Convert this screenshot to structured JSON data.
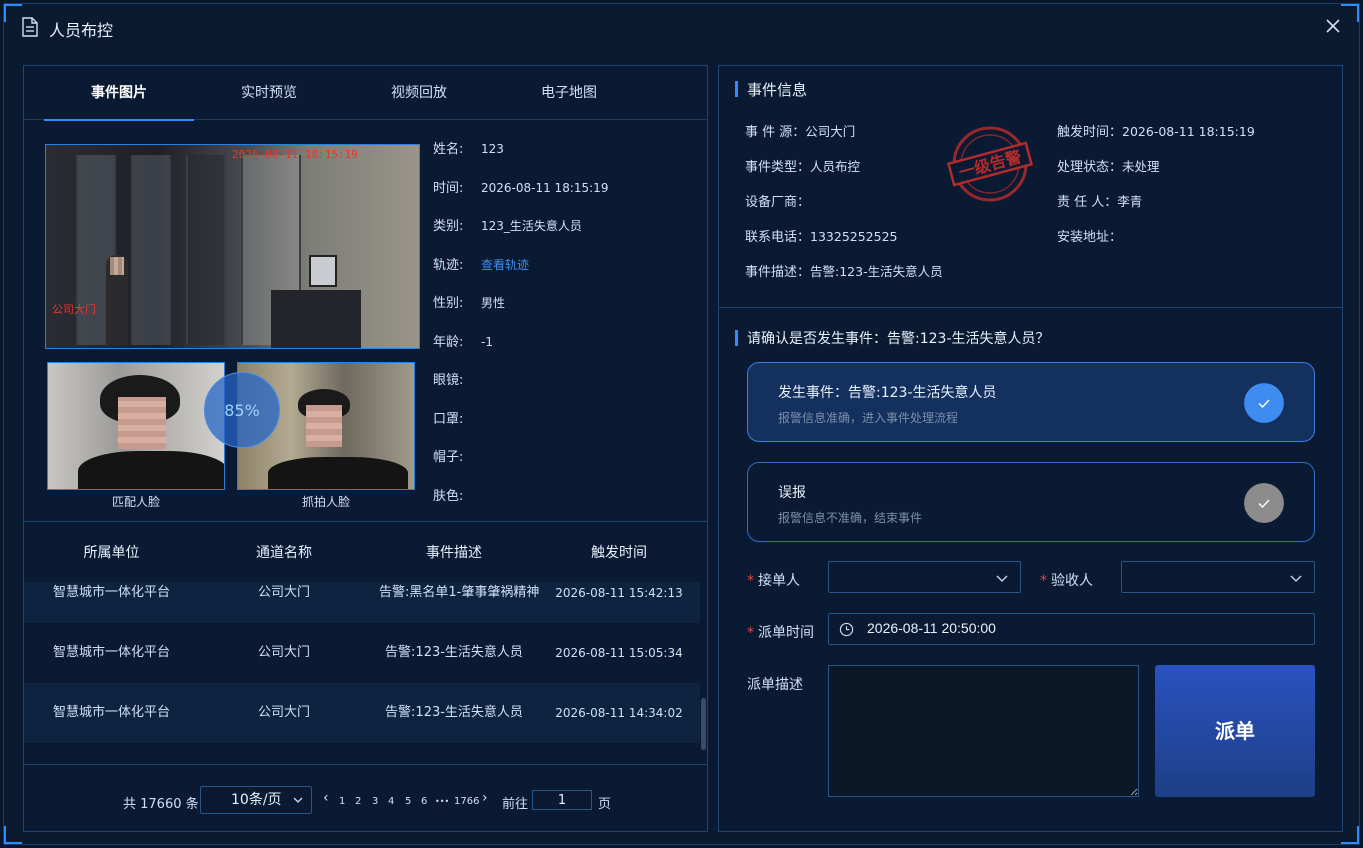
{
  "modal": {
    "title": "人员布控"
  },
  "tabs": [
    "事件图片",
    "实时预览",
    "视频回放",
    "电子地图"
  ],
  "scene": {
    "timestamp_overlay": "2026-08-11 18:15:19",
    "location_overlay": "公司大门"
  },
  "faces": {
    "similarity": "85%",
    "match_label": "匹配人脸",
    "snap_label": "抓拍人脸"
  },
  "person_info": [
    {
      "key": "姓名:",
      "value": "123"
    },
    {
      "key": "时间:",
      "value": "2026-08-11 18:15:19"
    },
    {
      "key": "类别:",
      "value": "123_生活失意人员"
    },
    {
      "key": "轨迹:",
      "value": "查看轨迹",
      "link": true
    },
    {
      "key": "性别:",
      "value": "男性"
    },
    {
      "key": "年龄:",
      "value": "-1"
    },
    {
      "key": "眼镜:",
      "value": ""
    },
    {
      "key": "口罩:",
      "value": ""
    },
    {
      "key": "帽子:",
      "value": ""
    },
    {
      "key": "肤色:",
      "value": ""
    }
  ],
  "table": {
    "headers": [
      "所属单位",
      "通道名称",
      "事件描述",
      "触发时间"
    ],
    "rows": [
      [
        "智慧城市一体化平台",
        "公司大门",
        "告警:黑名单1-肇事肇祸精神",
        "2026-08-11 15:42:13"
      ],
      [
        "智慧城市一体化平台",
        "公司大门",
        "告警:123-生活失意人员",
        "2026-08-11 15:05:34"
      ],
      [
        "智慧城市一体化平台",
        "公司大门",
        "告警:123-生活失意人员",
        "2026-08-11 14:34:02"
      ]
    ]
  },
  "pager": {
    "total": "共 17660 条",
    "page_size": "10条/页",
    "pages": [
      "1",
      "2",
      "3",
      "4",
      "5",
      "6",
      "•••",
      "1766"
    ],
    "goto_label": "前往",
    "goto_value": "1",
    "goto_suffix": "页"
  },
  "event_info": {
    "title": "事件信息",
    "stamp_text": "一级告警",
    "left": [
      {
        "key": "事 件 源：",
        "value": "公司大门"
      },
      {
        "key": "事件类型：",
        "value": "人员布控"
      },
      {
        "key": "设备厂商：",
        "value": ""
      },
      {
        "key": "联系电话：",
        "value": "13325252525"
      },
      {
        "key": "事件描述：",
        "value": "告警:123-生活失意人员"
      }
    ],
    "right": [
      {
        "key": "触发时间：",
        "value": "2026-08-11 18:15:19"
      },
      {
        "key": "处理状态：",
        "value": "未处理"
      },
      {
        "key": "责 任 人：",
        "value": "李青"
      },
      {
        "key": "安装地址：",
        "value": ""
      }
    ]
  },
  "confirm": {
    "question": "请确认是否发生事件：告警:123-生活失意人员？",
    "options": [
      {
        "title": "发生事件：告警:123-生活失意人员",
        "sub": "报警信息准确，进入事件处理流程",
        "active": true
      },
      {
        "title": "误报",
        "sub": "报警信息不准确，结束事件",
        "active": false
      }
    ]
  },
  "form": {
    "receiver_label": "接单人",
    "checker_label": "验收人",
    "dispatch_time_label": "派单时间",
    "dispatch_time_value": "2026-08-11 20:50:00",
    "desc_label": "派单描述",
    "submit_label": "派单"
  },
  "colors": {
    "accent": "#2f8cff",
    "active_check": "#3f8cf0",
    "inactive_check": "#8c8c8c",
    "stamp": "#b32b2b"
  }
}
